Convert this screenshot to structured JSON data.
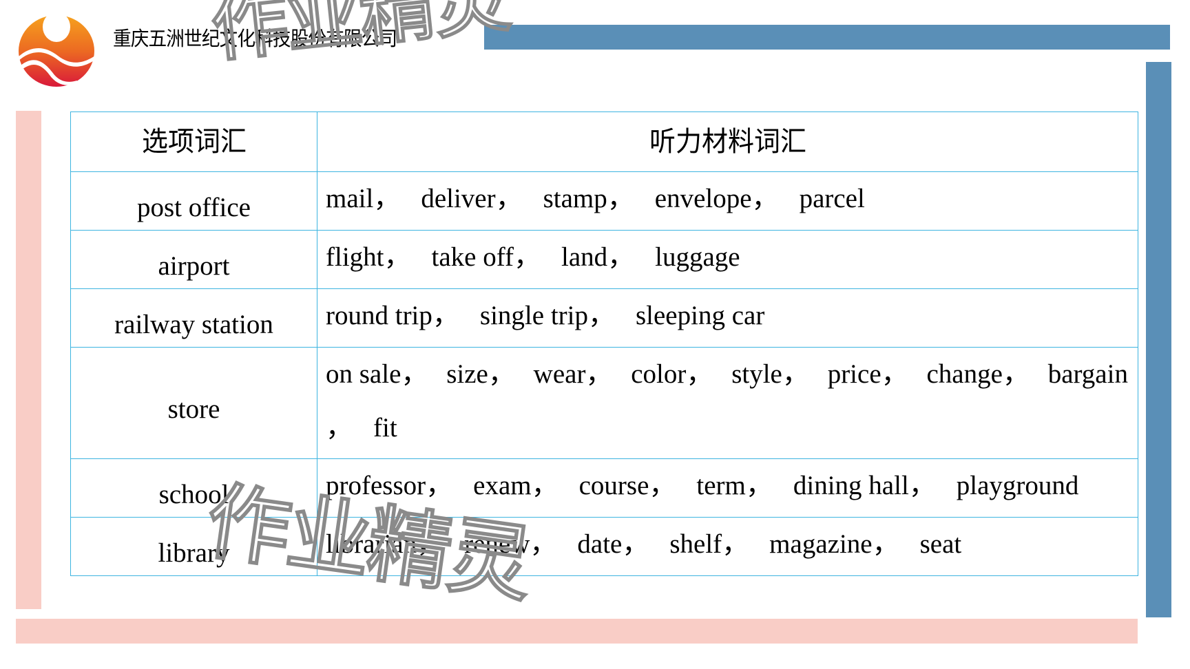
{
  "header": {
    "logo": "company-logo",
    "company_name": "重庆五洲世纪文化科技股份有限公司"
  },
  "colors": {
    "accent_blue": "#5a8fb7",
    "accent_pink": "#f9cdc6",
    "table_border": "#3cb4e0"
  },
  "table": {
    "headers": [
      "选项词汇",
      "听力材料词汇"
    ],
    "rows": [
      {
        "option": "post office",
        "words": [
          "mail，",
          "deliver，",
          "stamp，",
          "envelope，",
          "parcel"
        ]
      },
      {
        "option": "airport",
        "words": [
          "flight，",
          "take off，",
          "land，",
          "luggage"
        ]
      },
      {
        "option": "railway station",
        "words": [
          "round trip，",
          "single trip，",
          "sleeping car"
        ]
      },
      {
        "option": "store",
        "words": [
          "on sale，",
          "size，",
          "wear，",
          "color，",
          "style，",
          "price，",
          "change，",
          "bargain",
          "，",
          "fit"
        ]
      },
      {
        "option": "school",
        "words": [
          "professor，",
          "exam，",
          "course，",
          "term，",
          "dining hall，",
          "playground"
        ]
      },
      {
        "option": "library",
        "words": [
          "librarian，",
          "renew，",
          "date，",
          "shelf，",
          "magazine，",
          "seat"
        ]
      }
    ]
  },
  "watermark": {
    "text": "作业精灵"
  }
}
